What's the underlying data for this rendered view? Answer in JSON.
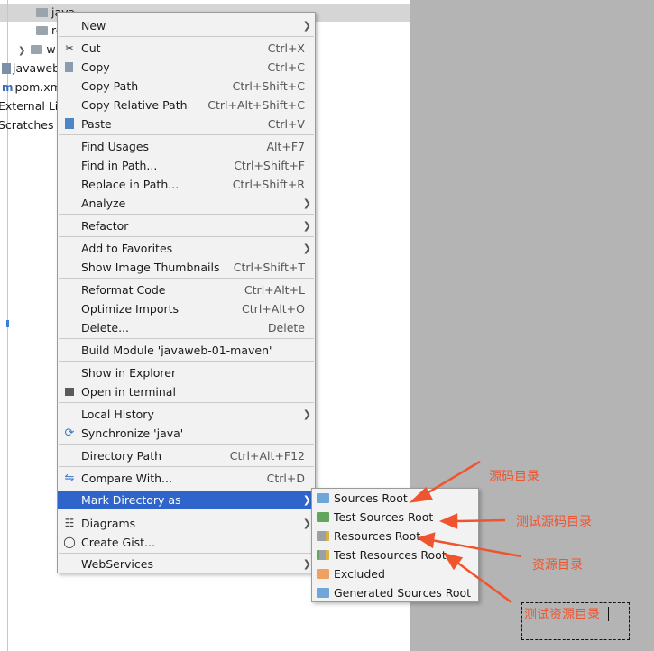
{
  "tree": {
    "rows": [
      {
        "name": "tree-folder-java",
        "label": "java"
      },
      {
        "name": "tree-folder-re",
        "label": "re"
      },
      {
        "name": "tree-folder-w",
        "label": "w"
      },
      {
        "name": "tree-item-javaweb",
        "label": "javaweb"
      },
      {
        "name": "tree-item-pom",
        "label": "pom.xm"
      },
      {
        "name": "tree-item-external",
        "label": "External Lib"
      },
      {
        "name": "tree-item-scratches",
        "label": "Scratches ar"
      }
    ]
  },
  "menu": {
    "items": [
      {
        "label": "New",
        "shortcut": "",
        "submenu": true
      },
      {
        "label": "Cut",
        "shortcut": "Ctrl+X",
        "icon": "scissors-icon"
      },
      {
        "label": "Copy",
        "shortcut": "Ctrl+C",
        "icon": "copy-icon"
      },
      {
        "label": "Copy Path",
        "shortcut": "Ctrl+Shift+C"
      },
      {
        "label": "Copy Relative Path",
        "shortcut": "Ctrl+Alt+Shift+C"
      },
      {
        "label": "Paste",
        "shortcut": "Ctrl+V",
        "icon": "paste-icon"
      },
      {
        "label": "Find Usages",
        "shortcut": "Alt+F7"
      },
      {
        "label": "Find in Path...",
        "shortcut": "Ctrl+Shift+F"
      },
      {
        "label": "Replace in Path...",
        "shortcut": "Ctrl+Shift+R"
      },
      {
        "label": "Analyze",
        "shortcut": "",
        "submenu": true
      },
      {
        "label": "Refactor",
        "shortcut": "",
        "submenu": true
      },
      {
        "label": "Add to Favorites",
        "shortcut": "",
        "submenu": true
      },
      {
        "label": "Show Image Thumbnails",
        "shortcut": "Ctrl+Shift+T"
      },
      {
        "label": "Reformat Code",
        "shortcut": "Ctrl+Alt+L"
      },
      {
        "label": "Optimize Imports",
        "shortcut": "Ctrl+Alt+O"
      },
      {
        "label": "Delete...",
        "shortcut": "Delete"
      },
      {
        "label": "Build Module 'javaweb-01-maven'",
        "shortcut": ""
      },
      {
        "label": "Show in Explorer",
        "shortcut": ""
      },
      {
        "label": "Open in terminal",
        "shortcut": "",
        "icon": "terminal-icon"
      },
      {
        "label": "Local History",
        "shortcut": "",
        "submenu": true
      },
      {
        "label": "Synchronize 'java'",
        "shortcut": "",
        "icon": "sync-icon"
      },
      {
        "label": "Directory Path",
        "shortcut": "Ctrl+Alt+F12"
      },
      {
        "label": "Compare With...",
        "shortcut": "Ctrl+D",
        "icon": "compare-icon"
      },
      {
        "label": "Mark Directory as",
        "shortcut": "",
        "submenu": true,
        "active": true
      },
      {
        "label": "Diagrams",
        "shortcut": "",
        "submenu": true,
        "icon": "diagram-icon"
      },
      {
        "label": "Create Gist...",
        "shortcut": "",
        "icon": "github-icon"
      },
      {
        "label": "WebServices",
        "shortcut": "",
        "submenu": true
      }
    ]
  },
  "submenu": {
    "items": [
      {
        "label": "Sources Root",
        "color": "#6fa6d8"
      },
      {
        "label": "Test Sources Root",
        "color": "#62a55c"
      },
      {
        "label": "Resources Root",
        "color": "#9aa0a6"
      },
      {
        "label": "Test Resources Root",
        "color": "#9aa0a6"
      },
      {
        "label": "Excluded",
        "color": "#f0a060"
      },
      {
        "label": "Generated Sources Root",
        "color": "#6fa6d8"
      }
    ]
  },
  "annotations": {
    "sources": "源码目录",
    "test_sources": "测试源码目录",
    "resources": "资源目录",
    "test_resources": "测试资源目录",
    "accent": "#f0542e"
  }
}
